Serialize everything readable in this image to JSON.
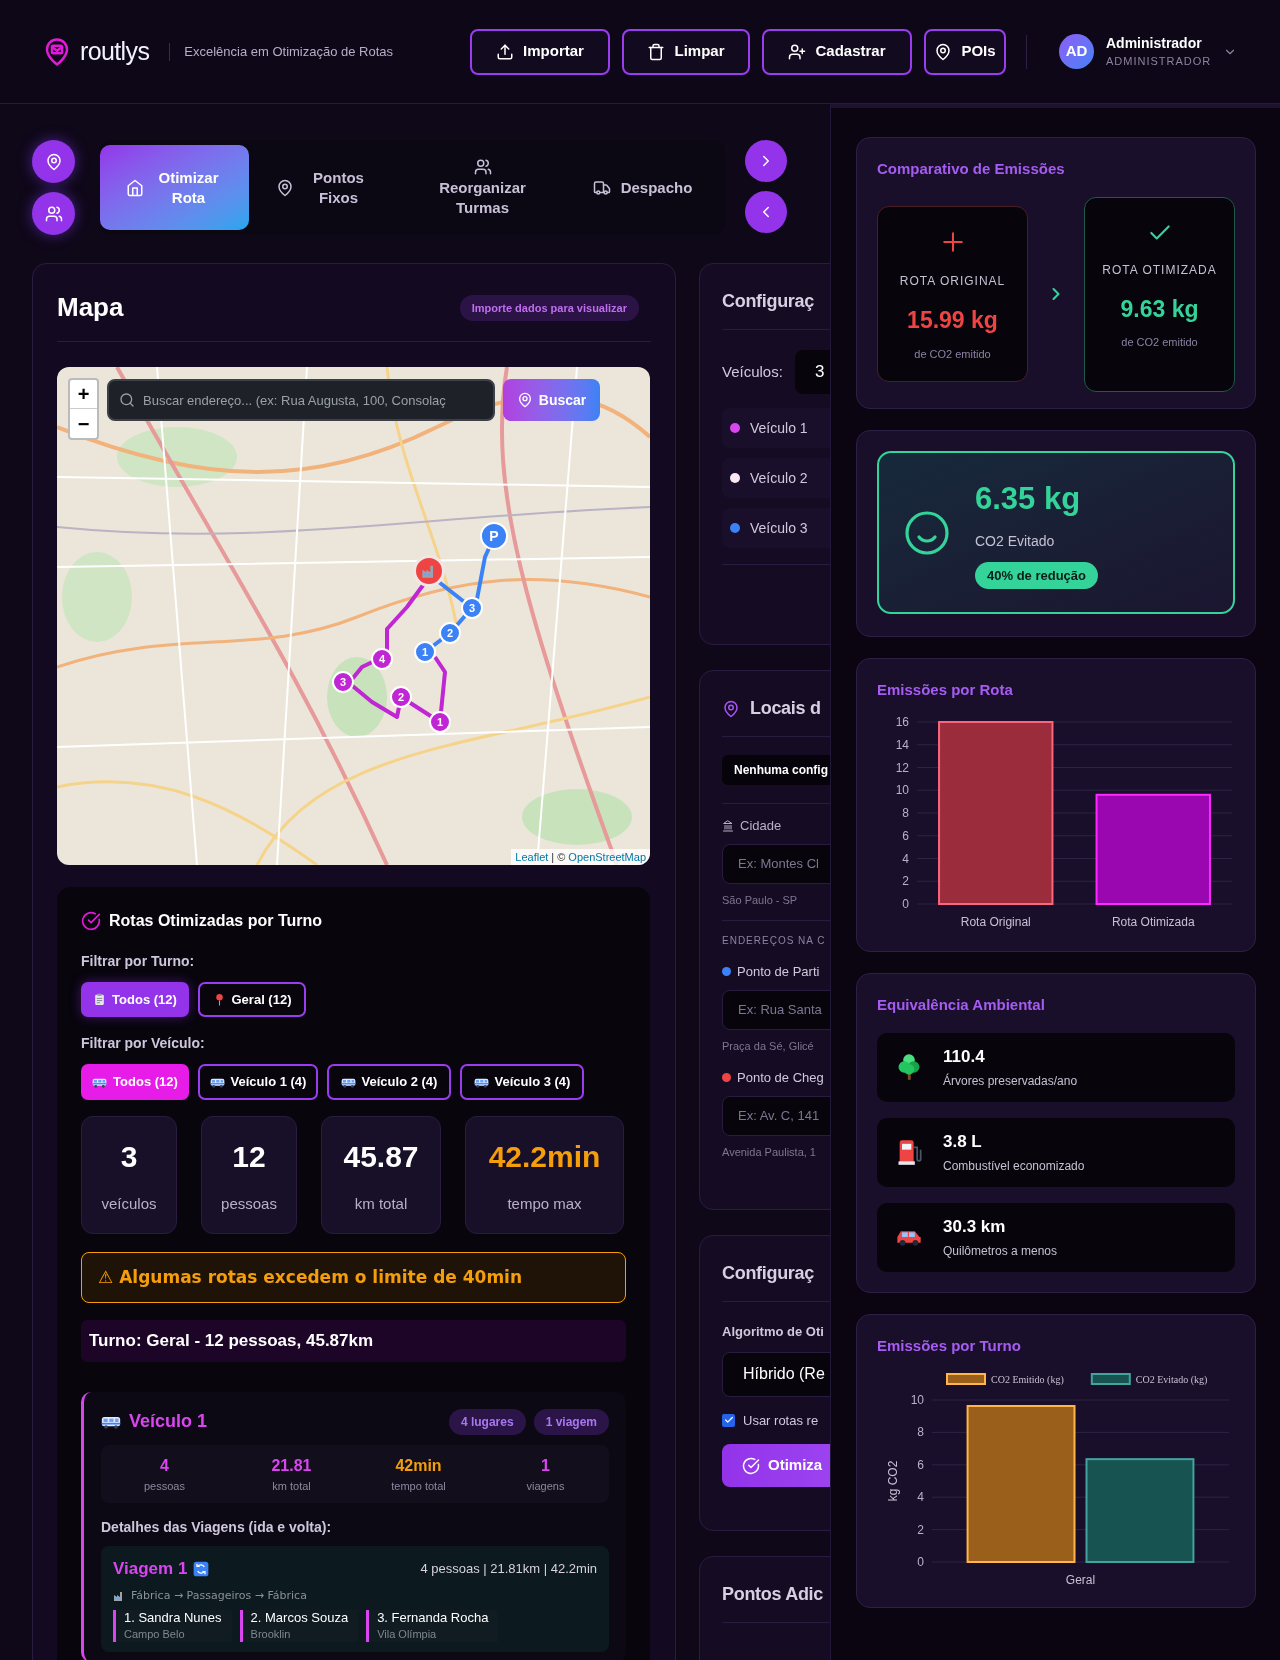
{
  "header": {
    "brand": "routlys",
    "tagline": "Excelência em Otimização de Rotas",
    "actions": [
      {
        "label": "Importar",
        "kind": "upload"
      },
      {
        "label": "Limpar",
        "kind": "trash"
      },
      {
        "label": "Cadastrar",
        "kind": "user-add"
      },
      {
        "label": "POIs",
        "kind": "pin"
      }
    ],
    "user": {
      "initials": "AD",
      "name": "Administrador",
      "role": "ADMINISTRADOR"
    }
  },
  "tabs": [
    {
      "label": "Otimizar Rota",
      "kind": "home",
      "selected": true
    },
    {
      "label": "Pontos Fixos",
      "kind": "pin",
      "selected": false
    },
    {
      "label": "Reorganizar Turmas",
      "kind": "users",
      "selected": false
    },
    {
      "label": "Despacho",
      "kind": "truck",
      "selected": false
    }
  ],
  "map_panel": {
    "title": "Mapa",
    "badge": "Importe dados para visualizar",
    "map": {
      "zoom_in": "+",
      "zoom_out": "−",
      "search_placeholder": "Buscar endereço... (ex: Rua Augusta, 100, Consolaç",
      "search_button": "Buscar",
      "markers": [
        {
          "label": "4",
          "color": "#c026d3"
        },
        {
          "label": "3",
          "color": "#c026d3"
        },
        {
          "label": "2",
          "color": "#c026d3"
        },
        {
          "label": "1",
          "color": "#c026d3"
        },
        {
          "label": "1",
          "color": "#3b82f6"
        },
        {
          "label": "2",
          "color": "#3b82f6"
        },
        {
          "label": "3",
          "color": "#3b82f6"
        },
        {
          "label": "P",
          "color": "#3b82f6"
        }
      ],
      "attribution_link": "Leaflet",
      "attribution_text": "| ©",
      "attribution_source": "OpenStreetMap"
    }
  },
  "routes": {
    "title": "Rotas Otimizadas por Turno",
    "shift_filter_label": "Filtrar por Turno:",
    "shift_filters": [
      {
        "label": "Todos (12)",
        "kind": "clipboard",
        "selected": true
      },
      {
        "label": "Geral (12)",
        "kind": "pin",
        "selected": false
      }
    ],
    "vehicle_filter_label": "Filtrar por Veículo:",
    "vehicle_filters": [
      {
        "label": "Todos (12)",
        "selected": true
      },
      {
        "label": "Veículo 1 (4)",
        "selected": false
      },
      {
        "label": "Veículo 2 (4)",
        "selected": false
      },
      {
        "label": "Veículo 3 (4)",
        "selected": false
      }
    ],
    "stats": [
      {
        "value": "3",
        "label": "veículos",
        "warning": false
      },
      {
        "value": "12",
        "label": "pessoas",
        "warning": false
      },
      {
        "value": "45.87",
        "label": "km total",
        "warning": false
      },
      {
        "value": "42.2min",
        "label": "tempo max",
        "warning": true
      }
    ],
    "warning": "⚠ Algumas rotas excedem o limite de 40min",
    "shift_summary": "Turno: Geral - 12 pessoas, 45.87km",
    "vehicle": {
      "name": "Veículo 1",
      "color": "#d946ef",
      "badges": [
        "4 lugares",
        "1 viagem"
      ],
      "stats": [
        {
          "value": "4",
          "label": "pessoas",
          "kind": "count"
        },
        {
          "value": "21.81",
          "label": "km total",
          "kind": "count"
        },
        {
          "value": "42min",
          "label": "tempo total",
          "kind": "time"
        },
        {
          "value": "1",
          "label": "viagens",
          "kind": "count"
        }
      ],
      "details_title": "Detalhes das Viagens (ida e volta):",
      "trips": [
        {
          "title": "Viagem 1",
          "summary": "4 pessoas | 21.81km | 42.2min",
          "path": "Fábrica → Passageiros → Fábrica",
          "passengers": [
            {
              "name": "1. Sandra Nunes",
              "place": "Campo Belo"
            },
            {
              "name": "2. Marcos Souza",
              "place": "Brooklin"
            },
            {
              "name": "3. Fernanda Rocha",
              "place": "Vila Olímpia"
            }
          ]
        }
      ]
    }
  },
  "config_panel": {
    "title": "Configuraç",
    "vehicles_label": "Veículos:",
    "vehicles_value": "3",
    "vehicles": [
      {
        "name": "Veículo 1",
        "color": "#d946ef"
      },
      {
        "name": "Veículo 2",
        "color": "#fce7f3"
      },
      {
        "name": "Veículo 3",
        "color": "#3b82f6"
      }
    ]
  },
  "locations_panel": {
    "title": "Locais d",
    "preset": "Nenhuma config",
    "city_label": "Cidade",
    "city_placeholder": "Ex: Montes Cl",
    "city_hint": "São Paulo - SP",
    "section_label": "ENDEREÇOS NA C",
    "points": [
      {
        "label": "Ponto de Parti",
        "color": "#3b82f6",
        "placeholder": "Ex: Rua Santa",
        "hint": "Praça da Sé, Glicé"
      },
      {
        "label": "Ponto de Cheg",
        "color": "#ef4444",
        "placeholder": "Ex: Av. C, 141",
        "hint": "Avenida Paulista, 1"
      }
    ]
  },
  "optimization_panel": {
    "title": "Configuraç",
    "algorithm_label": "Algoritmo de Oti",
    "algorithm_value": "Híbrido (Re",
    "real_routes": {
      "label": "Usar rotas re",
      "checked": true
    },
    "submit": "Otimiza"
  },
  "extra_points_panel": {
    "title": "Pontos Adic"
  },
  "emissions": {
    "title": "Comparativo de Emissões",
    "original": {
      "label": "ROTA ORIGINAL",
      "value": "15.99 kg",
      "note": "de CO2 emitido"
    },
    "optimized": {
      "label": "ROTA OTIMIZADA",
      "value": "9.63 kg",
      "note": "de CO2 emitido"
    }
  },
  "avoided": {
    "value": "6.35 kg",
    "label": "CO2 Evitado",
    "badge": "40% de redução"
  },
  "route_chart": {
    "title": "Emissões por Rota",
    "chart_data": {
      "type": "bar",
      "categories": [
        "Rota Original",
        "Rota Otimizada"
      ],
      "values": [
        16.0,
        9.6
      ],
      "colors": [
        "#9b2c3b",
        "#9a06b0"
      ],
      "ylim": [
        0,
        16
      ],
      "yticks": [
        0,
        2,
        4,
        6,
        8,
        10,
        12,
        14,
        16
      ],
      "grid": true
    }
  },
  "equivalence": {
    "title": "Equivalência Ambiental",
    "items": [
      {
        "kind": "tree",
        "value": "110.4",
        "label": "Árvores preservadas/ano"
      },
      {
        "kind": "fuel",
        "value": "3.8 L",
        "label": "Combustível economizado"
      },
      {
        "kind": "car",
        "value": "30.3 km",
        "label": "Quilômetros a menos"
      }
    ]
  },
  "shift_chart": {
    "title": "Emissões por Turno",
    "chart_data": {
      "type": "bar",
      "ylabel": "kg CO2",
      "categories": [
        "Geral"
      ],
      "series": [
        {
          "name": "CO2 Emitido (kg)",
          "color": "#9a5f1a",
          "values": [
            9.63
          ]
        },
        {
          "name": "CO2 Evitado (kg)",
          "color": "#175350",
          "values": [
            6.35
          ]
        }
      ],
      "ylim": [
        0,
        10
      ],
      "yticks": [
        0,
        2,
        4,
        6,
        8,
        10
      ],
      "grid": true,
      "legend": "top"
    }
  }
}
